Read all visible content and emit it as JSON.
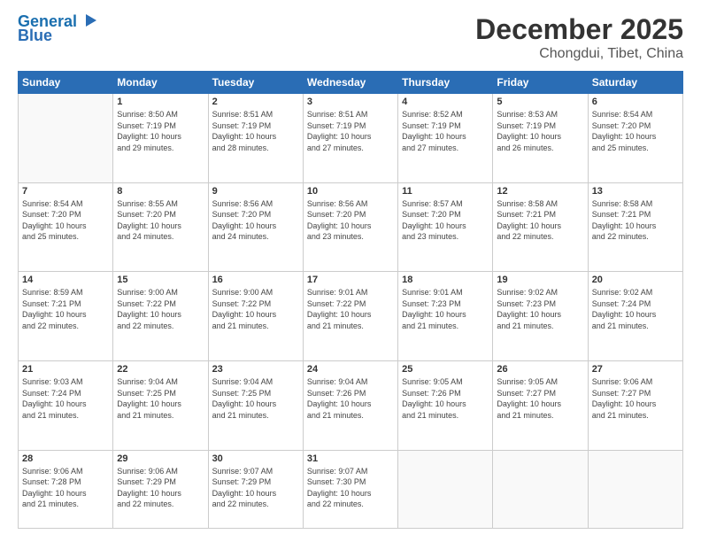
{
  "logo": {
    "line1": "General",
    "line2": "Blue"
  },
  "header": {
    "month": "December 2025",
    "location": "Chongdui, Tibet, China"
  },
  "days": [
    "Sunday",
    "Monday",
    "Tuesday",
    "Wednesday",
    "Thursday",
    "Friday",
    "Saturday"
  ],
  "weeks": [
    [
      {
        "day": "",
        "info": ""
      },
      {
        "day": "1",
        "info": "Sunrise: 8:50 AM\nSunset: 7:19 PM\nDaylight: 10 hours\nand 29 minutes."
      },
      {
        "day": "2",
        "info": "Sunrise: 8:51 AM\nSunset: 7:19 PM\nDaylight: 10 hours\nand 28 minutes."
      },
      {
        "day": "3",
        "info": "Sunrise: 8:51 AM\nSunset: 7:19 PM\nDaylight: 10 hours\nand 27 minutes."
      },
      {
        "day": "4",
        "info": "Sunrise: 8:52 AM\nSunset: 7:19 PM\nDaylight: 10 hours\nand 27 minutes."
      },
      {
        "day": "5",
        "info": "Sunrise: 8:53 AM\nSunset: 7:19 PM\nDaylight: 10 hours\nand 26 minutes."
      },
      {
        "day": "6",
        "info": "Sunrise: 8:54 AM\nSunset: 7:20 PM\nDaylight: 10 hours\nand 25 minutes."
      }
    ],
    [
      {
        "day": "7",
        "info": "Sunrise: 8:54 AM\nSunset: 7:20 PM\nDaylight: 10 hours\nand 25 minutes."
      },
      {
        "day": "8",
        "info": "Sunrise: 8:55 AM\nSunset: 7:20 PM\nDaylight: 10 hours\nand 24 minutes."
      },
      {
        "day": "9",
        "info": "Sunrise: 8:56 AM\nSunset: 7:20 PM\nDaylight: 10 hours\nand 24 minutes."
      },
      {
        "day": "10",
        "info": "Sunrise: 8:56 AM\nSunset: 7:20 PM\nDaylight: 10 hours\nand 23 minutes."
      },
      {
        "day": "11",
        "info": "Sunrise: 8:57 AM\nSunset: 7:20 PM\nDaylight: 10 hours\nand 23 minutes."
      },
      {
        "day": "12",
        "info": "Sunrise: 8:58 AM\nSunset: 7:21 PM\nDaylight: 10 hours\nand 22 minutes."
      },
      {
        "day": "13",
        "info": "Sunrise: 8:58 AM\nSunset: 7:21 PM\nDaylight: 10 hours\nand 22 minutes."
      }
    ],
    [
      {
        "day": "14",
        "info": "Sunrise: 8:59 AM\nSunset: 7:21 PM\nDaylight: 10 hours\nand 22 minutes."
      },
      {
        "day": "15",
        "info": "Sunrise: 9:00 AM\nSunset: 7:22 PM\nDaylight: 10 hours\nand 22 minutes."
      },
      {
        "day": "16",
        "info": "Sunrise: 9:00 AM\nSunset: 7:22 PM\nDaylight: 10 hours\nand 21 minutes."
      },
      {
        "day": "17",
        "info": "Sunrise: 9:01 AM\nSunset: 7:22 PM\nDaylight: 10 hours\nand 21 minutes."
      },
      {
        "day": "18",
        "info": "Sunrise: 9:01 AM\nSunset: 7:23 PM\nDaylight: 10 hours\nand 21 minutes."
      },
      {
        "day": "19",
        "info": "Sunrise: 9:02 AM\nSunset: 7:23 PM\nDaylight: 10 hours\nand 21 minutes."
      },
      {
        "day": "20",
        "info": "Sunrise: 9:02 AM\nSunset: 7:24 PM\nDaylight: 10 hours\nand 21 minutes."
      }
    ],
    [
      {
        "day": "21",
        "info": "Sunrise: 9:03 AM\nSunset: 7:24 PM\nDaylight: 10 hours\nand 21 minutes."
      },
      {
        "day": "22",
        "info": "Sunrise: 9:04 AM\nSunset: 7:25 PM\nDaylight: 10 hours\nand 21 minutes."
      },
      {
        "day": "23",
        "info": "Sunrise: 9:04 AM\nSunset: 7:25 PM\nDaylight: 10 hours\nand 21 minutes."
      },
      {
        "day": "24",
        "info": "Sunrise: 9:04 AM\nSunset: 7:26 PM\nDaylight: 10 hours\nand 21 minutes."
      },
      {
        "day": "25",
        "info": "Sunrise: 9:05 AM\nSunset: 7:26 PM\nDaylight: 10 hours\nand 21 minutes."
      },
      {
        "day": "26",
        "info": "Sunrise: 9:05 AM\nSunset: 7:27 PM\nDaylight: 10 hours\nand 21 minutes."
      },
      {
        "day": "27",
        "info": "Sunrise: 9:06 AM\nSunset: 7:27 PM\nDaylight: 10 hours\nand 21 minutes."
      }
    ],
    [
      {
        "day": "28",
        "info": "Sunrise: 9:06 AM\nSunset: 7:28 PM\nDaylight: 10 hours\nand 21 minutes."
      },
      {
        "day": "29",
        "info": "Sunrise: 9:06 AM\nSunset: 7:29 PM\nDaylight: 10 hours\nand 22 minutes."
      },
      {
        "day": "30",
        "info": "Sunrise: 9:07 AM\nSunset: 7:29 PM\nDaylight: 10 hours\nand 22 minutes."
      },
      {
        "day": "31",
        "info": "Sunrise: 9:07 AM\nSunset: 7:30 PM\nDaylight: 10 hours\nand 22 minutes."
      },
      {
        "day": "",
        "info": ""
      },
      {
        "day": "",
        "info": ""
      },
      {
        "day": "",
        "info": ""
      }
    ]
  ]
}
